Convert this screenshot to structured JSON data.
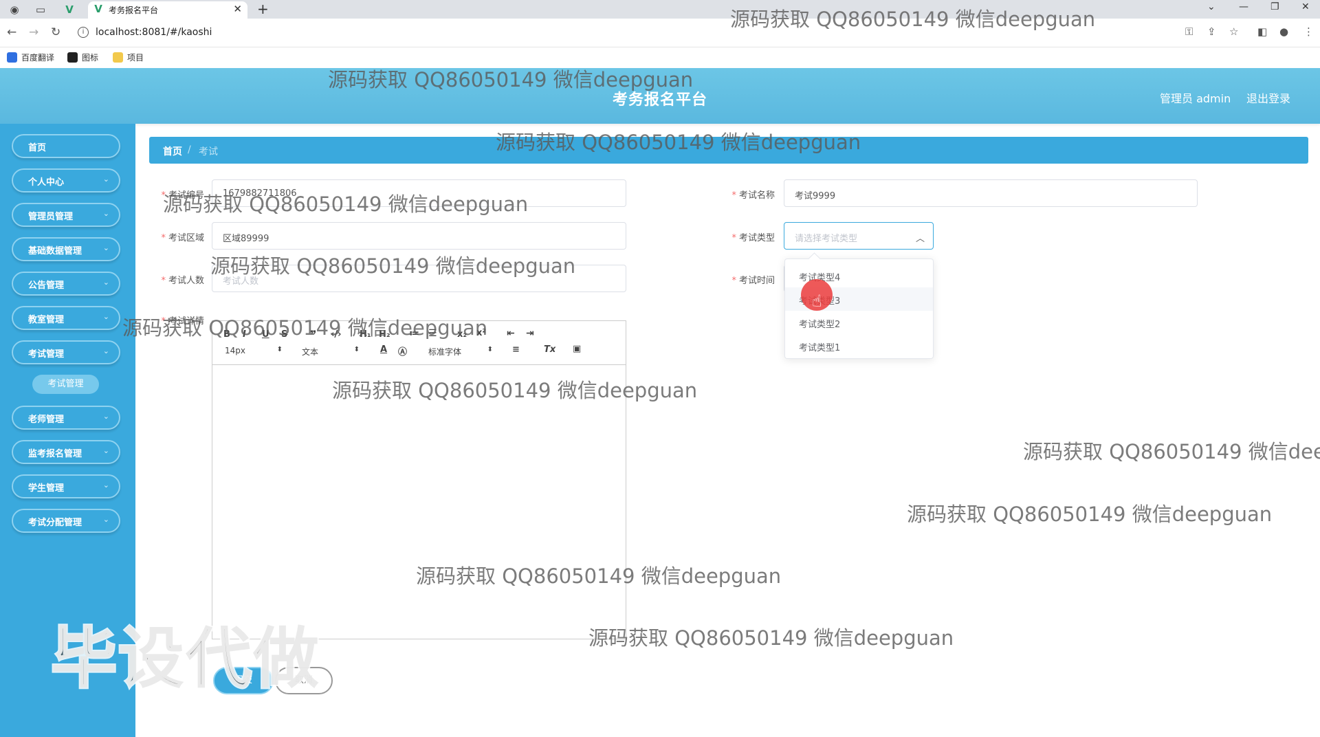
{
  "browser": {
    "tab_title": "考务报名平台",
    "url": "localhost:8081/#/kaoshi",
    "bookmarks": [
      "百度翻译",
      "图标",
      "项目"
    ]
  },
  "header": {
    "title": "考务报名平台",
    "admin_label": "管理员 admin",
    "logout_label": "退出登录"
  },
  "sidebar": {
    "items": [
      {
        "label": "首页",
        "has_chevron": false
      },
      {
        "label": "个人中心",
        "has_chevron": true
      },
      {
        "label": "管理员管理",
        "has_chevron": true
      },
      {
        "label": "基础数据管理",
        "has_chevron": true
      },
      {
        "label": "公告管理",
        "has_chevron": true
      },
      {
        "label": "教室管理",
        "has_chevron": true
      },
      {
        "label": "考试管理",
        "has_chevron": true
      },
      {
        "label": "老师管理",
        "has_chevron": true
      },
      {
        "label": "监考报名管理",
        "has_chevron": true
      },
      {
        "label": "学生管理",
        "has_chevron": true
      },
      {
        "label": "考试分配管理",
        "has_chevron": true
      }
    ],
    "active_sub": "考试管理"
  },
  "breadcrumb": {
    "home": "首页",
    "separator": "/",
    "current": "考试"
  },
  "form": {
    "exam_no": {
      "label": "考试编号",
      "value": "1679882711806"
    },
    "exam_name": {
      "label": "考试名称",
      "value": "考试9999"
    },
    "exam_area": {
      "label": "考试区域",
      "value": "区域89999"
    },
    "exam_type": {
      "label": "考试类型",
      "placeholder": "请选择考试类型"
    },
    "exam_count": {
      "label": "考试人数",
      "placeholder": "考试人数"
    },
    "exam_time": {
      "label": "考试时间"
    },
    "exam_detail": {
      "label": "考试详情"
    },
    "type_options": [
      "考试类型4",
      "考试类型3",
      "考试类型2",
      "考试类型1"
    ]
  },
  "editor": {
    "font_size": "14px",
    "block_type": "文本",
    "font_family": "标准字体"
  },
  "buttons": {
    "submit": "提交",
    "cancel": "取消"
  },
  "watermark": {
    "text": "源码获取 QQ86050149 微信deepguan",
    "text_cut": "源码获取 QQ86050149 微信dee",
    "big": "毕设代做"
  },
  "colors": {
    "primary": "#3aa9dd",
    "header": "#5ab8df",
    "required": "#f56c6c"
  }
}
